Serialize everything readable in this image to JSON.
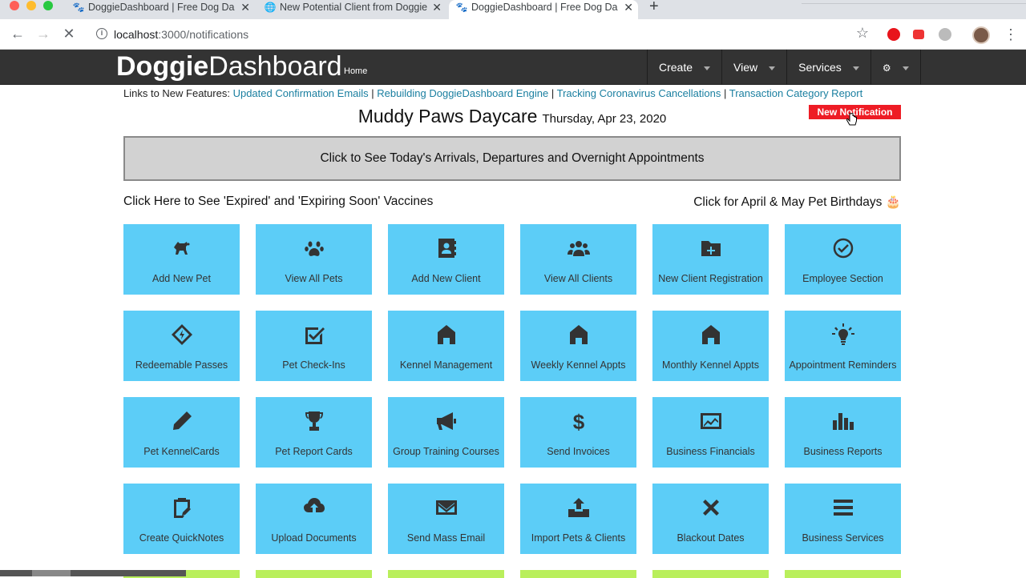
{
  "browser": {
    "tabs": [
      {
        "title": "DoggieDashboard | Free Dog Da",
        "favicon": "dog-icon",
        "active": false
      },
      {
        "title": "New Potential Client from Doggie",
        "favicon": "globe-icon",
        "active": false
      },
      {
        "title": "DoggieDashboard | Free Dog Da",
        "favicon": "dog-icon",
        "active": true
      }
    ],
    "url_host": "localhost",
    "url_path": ":3000/notifications"
  },
  "navbar": {
    "brand_bold": "Doggie",
    "brand_light": "Dashboard",
    "home": "Home",
    "menus": [
      {
        "label": "Create"
      },
      {
        "label": "View"
      },
      {
        "label": "Services"
      },
      {
        "label": "⚙"
      }
    ]
  },
  "features": {
    "prefix": "Links to New Features:",
    "links": [
      "Updated Confirmation Emails",
      "Rebuilding DoggieDashboard Engine",
      "Tracking Coronavirus Cancellations",
      "Transaction Category Report"
    ],
    "separator": "|"
  },
  "header": {
    "business_name": "Muddy Paws Daycare",
    "date": "Thursday, Apr 23, 2020",
    "notification_button": "New Notification"
  },
  "appointments_bar": "Click to See Today's Arrivals, Departures and Overnight Appointments",
  "vaccines_link": "Click Here to See 'Expired' and 'Expiring Soon' Vaccines",
  "birthdays_link": "Click for April & May Pet Birthdays 🎂",
  "tiles": [
    {
      "label": "Add New Pet",
      "icon": "dog-icon"
    },
    {
      "label": "View All Pets",
      "icon": "paw-icon"
    },
    {
      "label": "Add New Client",
      "icon": "contact-card-icon"
    },
    {
      "label": "View All Clients",
      "icon": "users-icon"
    },
    {
      "label": "New Client Registration",
      "icon": "folder-plus-icon"
    },
    {
      "label": "Employee Section",
      "icon": "check-circle-icon"
    },
    {
      "label": "Redeemable Passes",
      "icon": "ticket-icon"
    },
    {
      "label": "Pet Check-Ins",
      "icon": "checkbox-icon"
    },
    {
      "label": "Kennel Management",
      "icon": "house-icon"
    },
    {
      "label": "Weekly Kennel Appts",
      "icon": "house-icon"
    },
    {
      "label": "Monthly Kennel Appts",
      "icon": "house-icon"
    },
    {
      "label": "Appointment Reminders",
      "icon": "lightbulb-icon"
    },
    {
      "label": "Pet KennelCards",
      "icon": "pencil-icon"
    },
    {
      "label": "Pet Report Cards",
      "icon": "trophy-icon"
    },
    {
      "label": "Group Training Courses",
      "icon": "megaphone-icon"
    },
    {
      "label": "Send Invoices",
      "icon": "dollar-icon"
    },
    {
      "label": "Business Financials",
      "icon": "line-chart-icon"
    },
    {
      "label": "Business Reports",
      "icon": "bar-chart-icon"
    },
    {
      "label": "Create QuickNotes",
      "icon": "clipboard-icon"
    },
    {
      "label": "Upload Documents",
      "icon": "cloud-upload-icon"
    },
    {
      "label": "Send Mass Email",
      "icon": "envelope-icon"
    },
    {
      "label": "Import Pets & Clients",
      "icon": "import-icon"
    },
    {
      "label": "Blackout Dates",
      "icon": "x-mark-icon"
    },
    {
      "label": "Business Services",
      "icon": "menu-lines-icon"
    }
  ],
  "colors": {
    "tile_blue": "#5ccdf7",
    "tile_green": "#b9ef5c",
    "navbar_bg": "#333333",
    "notification_red": "#ee1c25",
    "link_teal": "#1a7fa0"
  }
}
